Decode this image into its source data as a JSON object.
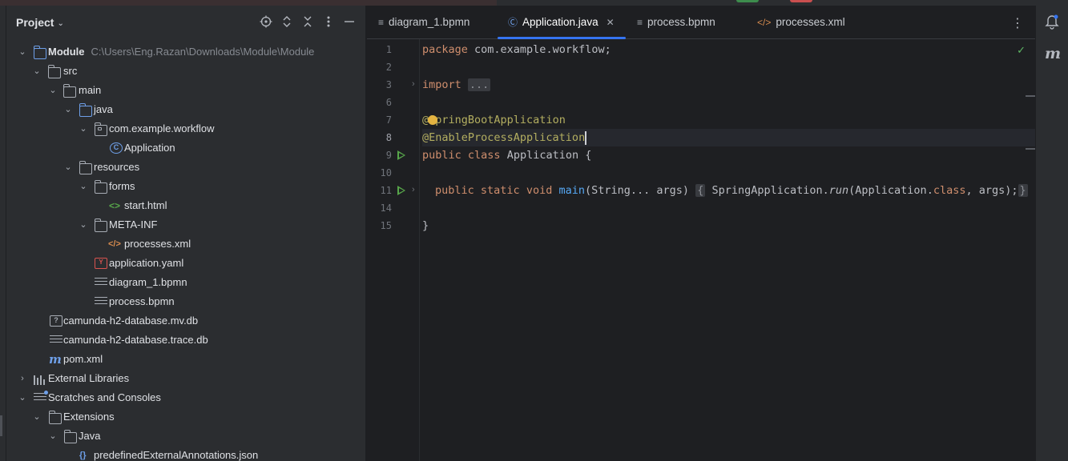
{
  "project_panel": {
    "title": "Project",
    "tree": [
      {
        "label": "Module",
        "path": "C:\\Users\\Eng.Razan\\Downloads\\Module\\Module"
      },
      {
        "label": "src"
      },
      {
        "label": "main"
      },
      {
        "label": "java"
      },
      {
        "label": "com.example.workflow"
      },
      {
        "label": "Application"
      },
      {
        "label": "resources"
      },
      {
        "label": "forms"
      },
      {
        "label": "start.html"
      },
      {
        "label": "META-INF"
      },
      {
        "label": "processes.xml"
      },
      {
        "label": "application.yaml"
      },
      {
        "label": "diagram_1.bpmn"
      },
      {
        "label": "process.bpmn"
      },
      {
        "label": "camunda-h2-database.mv.db"
      },
      {
        "label": "camunda-h2-database.trace.db"
      },
      {
        "label": "pom.xml"
      },
      {
        "label": "External Libraries"
      },
      {
        "label": "Scratches and Consoles"
      },
      {
        "label": "Extensions"
      },
      {
        "label": "Java"
      },
      {
        "label": "predefinedExternalAnnotations.json"
      }
    ]
  },
  "tabs": [
    {
      "label": "diagram_1.bpmn",
      "icon": "bpmn-file-icon"
    },
    {
      "label": "Application.java",
      "icon": "class-icon",
      "active": true
    },
    {
      "label": "process.bpmn",
      "icon": "bpmn-file-icon"
    },
    {
      "label": "processes.xml",
      "icon": "xml-file-icon"
    }
  ],
  "editor": {
    "line_numbers": [
      "1",
      "2",
      "3",
      "6",
      "7",
      "8",
      "9",
      "10",
      "11",
      "14",
      "15"
    ],
    "current_line": "8",
    "code": {
      "l1_kw": "package",
      "l1_rest": " com.example.workflow;",
      "l3_kw": "import",
      "l3_fold": "...",
      "l7_at": "@",
      "l7_ann": "SpringBootApplication",
      "l8_ann": "@EnableProcessApplication",
      "l9_kw1": "public",
      "l9_kw2": "class",
      "l9_rest": " Application {",
      "l11_kw1": "public",
      "l11_kw2": "static",
      "l11_kw3": "void",
      "l11_fn": "main",
      "l11_params": "(String... args) ",
      "l11_open": "{",
      "l11_call1": " SpringApplication.",
      "l11_run": "run",
      "l11_call2": "(Application.",
      "l11_class": "class",
      "l11_call3": ", args);",
      "l11_close": "}",
      "l15": "}"
    }
  },
  "colors": {
    "accent": "#3574f0",
    "keyword": "#cf8e6d",
    "annotation": "#b3ae60",
    "method": "#56a8f5",
    "run_gutter": "#57a64a"
  }
}
